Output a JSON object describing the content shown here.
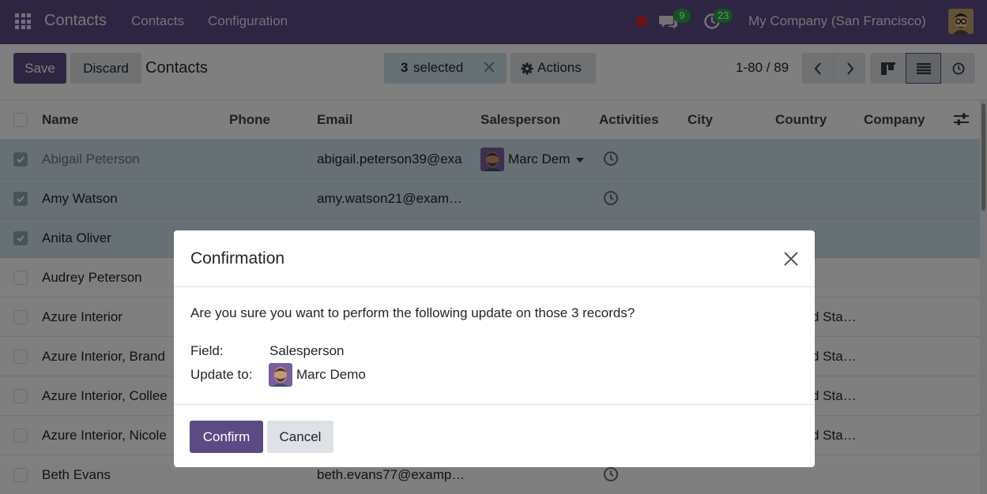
{
  "navbar": {
    "brand": "Contacts",
    "menus": [
      "Contacts",
      "Configuration"
    ],
    "messages_count": "9",
    "activities_count": "23",
    "company": "My Company (San Francisco)"
  },
  "control_panel": {
    "save_label": "Save",
    "discard_label": "Discard",
    "title": "Contacts",
    "selected_count": "3",
    "selected_text": "selected",
    "actions_label": "Actions",
    "pager": "1-80 / 89"
  },
  "list": {
    "columns": [
      "Name",
      "Phone",
      "Email",
      "Salesperson",
      "Activities",
      "City",
      "Country",
      "Company"
    ],
    "rows": [
      {
        "name": "Abigail Peterson",
        "email": "abigail.peterson39@exa",
        "salesperson": "Marc Dem",
        "country": "",
        "selected": true
      },
      {
        "name": "Amy Watson",
        "email": "amy.watson21@exam…",
        "salesperson": "",
        "country": "",
        "selected": true
      },
      {
        "name": "Anita Oliver",
        "email": "",
        "salesperson": "",
        "country": "",
        "selected": true
      },
      {
        "name": "Audrey Peterson",
        "email": "",
        "salesperson": "",
        "country": "",
        "selected": false
      },
      {
        "name": "Azure Interior",
        "email": "",
        "salesperson": "",
        "country": "d Sta…",
        "selected": false
      },
      {
        "name": "Azure Interior, Brand",
        "email": "",
        "salesperson": "",
        "country": "d Sta…",
        "selected": false
      },
      {
        "name": "Azure Interior, Collee",
        "email": "",
        "salesperson": "",
        "country": "d Sta…",
        "selected": false
      },
      {
        "name": "Azure Interior, Nicole",
        "email": "",
        "salesperson": "",
        "country": "d Sta…",
        "selected": false
      },
      {
        "name": "Beth Evans",
        "email": "beth.evans77@examp…",
        "salesperson": "",
        "country": "",
        "selected": false
      }
    ]
  },
  "modal": {
    "title": "Confirmation",
    "message": "Are you sure you want to perform the following update on those 3 records?",
    "field_label": "Field:",
    "field_value": "Salesperson",
    "update_label": "Update to:",
    "update_value": "Marc Demo",
    "confirm_label": "Confirm",
    "cancel_label": "Cancel"
  },
  "colors": {
    "brand": "#5b4a83",
    "selected_row": "#cfe1ea",
    "badge": "#28a745"
  }
}
